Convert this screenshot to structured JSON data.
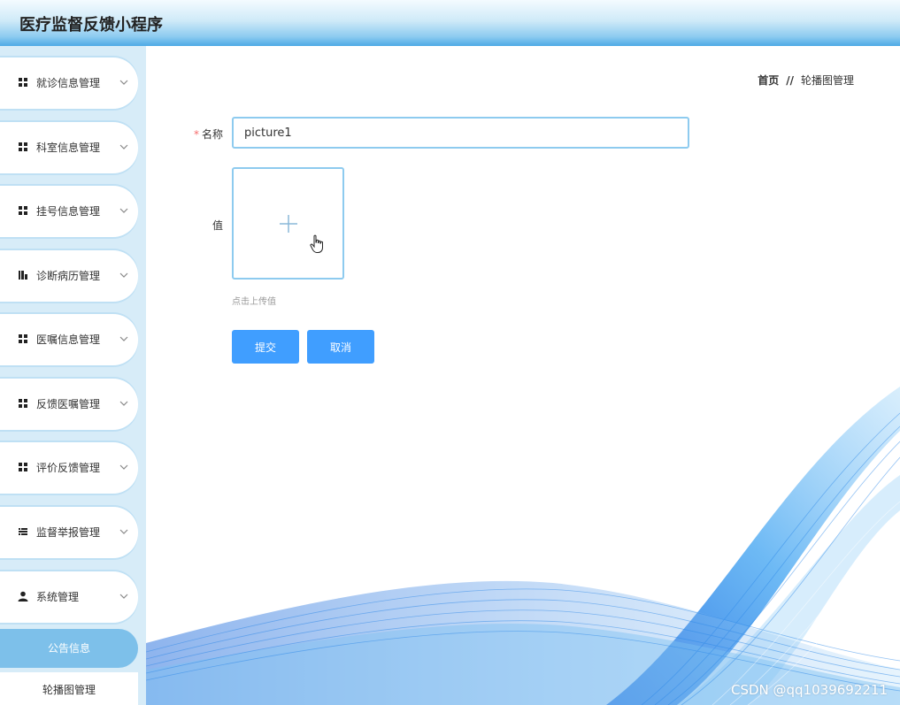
{
  "header": {
    "title": "医疗监督反馈小程序"
  },
  "sidebar": {
    "items": [
      {
        "label": "就诊信息管理",
        "icon": "grid-icon"
      },
      {
        "label": "科室信息管理",
        "icon": "grid-icon"
      },
      {
        "label": "挂号信息管理",
        "icon": "grid-icon"
      },
      {
        "label": "诊断病历管理",
        "icon": "chart-icon"
      },
      {
        "label": "医嘱信息管理",
        "icon": "grid-icon"
      },
      {
        "label": "反馈医嘱管理",
        "icon": "grid-icon"
      },
      {
        "label": "评价反馈管理",
        "icon": "grid-icon"
      },
      {
        "label": "监督举报管理",
        "icon": "list-icon"
      },
      {
        "label": "系统管理",
        "icon": "user-icon"
      }
    ],
    "subitems": [
      {
        "label": "公告信息",
        "active": true
      },
      {
        "label": "轮播图管理",
        "active": false
      }
    ]
  },
  "breadcrumb": {
    "home": "首页",
    "separator": "//",
    "current": "轮播图管理"
  },
  "form": {
    "required_mark": "*",
    "name_label": "名称",
    "name_value": "picture1",
    "value_label": "值",
    "upload_tip": "点击上传值",
    "submit_label": "提交",
    "cancel_label": "取消"
  },
  "watermark": "CSDN @qq1039692211",
  "colors": {
    "primary_button": "#409eff",
    "active_menu": "#7dc0ea",
    "input_border": "#8ecbef",
    "sidebar_bg": "#d7ecf8"
  }
}
